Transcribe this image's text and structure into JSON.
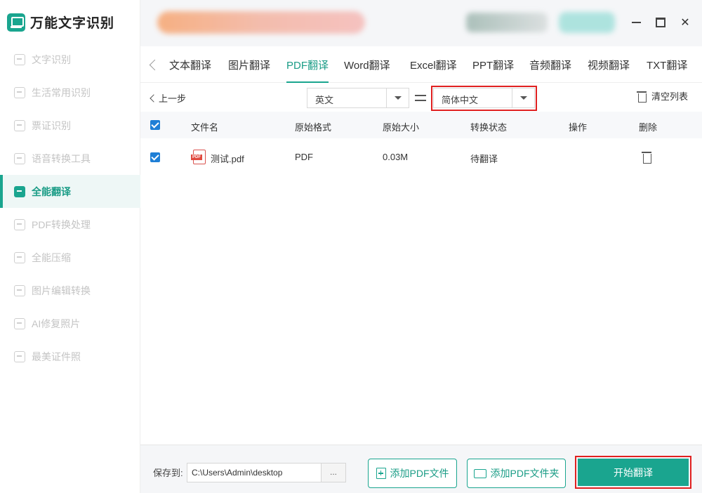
{
  "app": {
    "title": "万能文字识别"
  },
  "sidebar": {
    "items": [
      {
        "label": "文字识别",
        "icon": "text-recognition-icon"
      },
      {
        "label": "生活常用识别",
        "icon": "life-recognition-icon"
      },
      {
        "label": "票证识别",
        "icon": "ticket-recognition-icon"
      },
      {
        "label": "语音转换工具",
        "icon": "voice-convert-icon"
      },
      {
        "label": "全能翻译",
        "icon": "translate-icon",
        "active": true
      },
      {
        "label": "PDF转换处理",
        "icon": "pdf-convert-icon"
      },
      {
        "label": "全能压缩",
        "icon": "compress-icon"
      },
      {
        "label": "图片编辑转换",
        "icon": "image-edit-icon"
      },
      {
        "label": "AI修复照片",
        "icon": "ai-repair-icon"
      },
      {
        "label": "最美证件照",
        "icon": "id-photo-icon"
      }
    ]
  },
  "tabs": [
    {
      "label": "文本翻译"
    },
    {
      "label": "图片翻译"
    },
    {
      "label": "PDF翻译",
      "active": true
    },
    {
      "label": "Word翻译"
    },
    {
      "label": "Excel翻译"
    },
    {
      "label": "PPT翻译"
    },
    {
      "label": "音频翻译"
    },
    {
      "label": "视频翻译"
    },
    {
      "label": "TXT翻译"
    }
  ],
  "toolbar": {
    "back_label": "上一步",
    "source_lang": "英文",
    "target_lang": "简体中文",
    "clear_label": "清空列表"
  },
  "table": {
    "headers": [
      "文件名",
      "原始格式",
      "原始大小",
      "转换状态",
      "操作",
      "删除"
    ],
    "rows": [
      {
        "name": "测试.pdf",
        "format": "PDF",
        "size": "0.03M",
        "status": "待翻译",
        "action": ""
      }
    ]
  },
  "bottom": {
    "save_label": "保存到:",
    "save_path": "C:\\Users\\Admin\\desktop",
    "browse_label": "...",
    "add_file_label": "添加PDF文件",
    "add_folder_label": "添加PDF文件夹",
    "start_label": "开始翻译"
  },
  "colors": {
    "accent": "#1aa58f",
    "highlight": "#e02020",
    "checkbox": "#1f7fd6"
  }
}
